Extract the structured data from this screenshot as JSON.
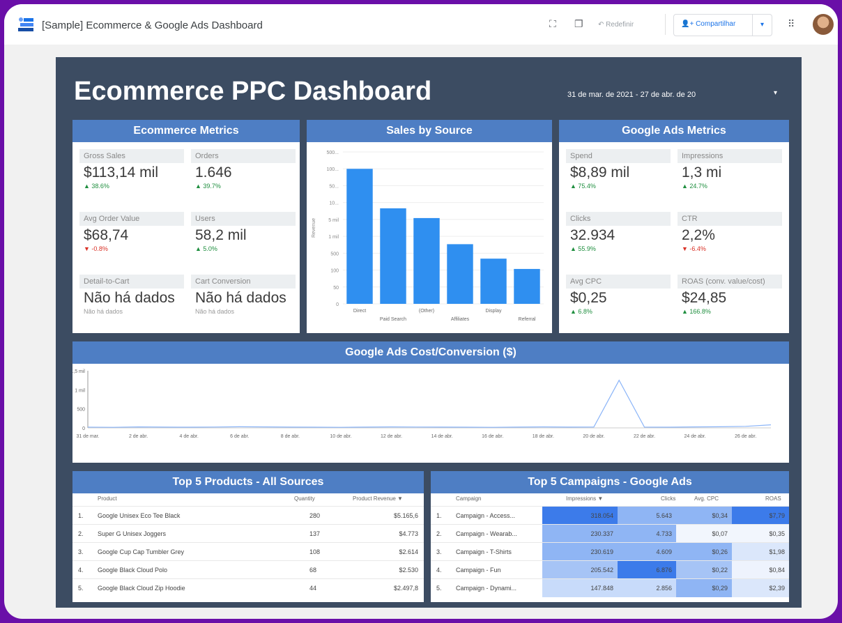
{
  "app": {
    "title": "[Sample] Ecommerce & Google Ads Dashboard",
    "reset_label": "Redefinir",
    "share_label": "Compartilhar"
  },
  "dashboard": {
    "title": "Ecommerce PPC Dashboard",
    "date_range": "31 de mar. de 2021 - 27 de abr. de 20"
  },
  "ecommerce_metrics": {
    "heading": "Ecommerce Metrics",
    "cards": [
      {
        "label": "Gross Sales",
        "value": "$113,14 mil",
        "delta": "▲ 38.6%",
        "trend": "up"
      },
      {
        "label": "Orders",
        "value": "1.646",
        "delta": "▲ 39.7%",
        "trend": "up"
      },
      {
        "label": "Avg Order Value",
        "value": "$68,74",
        "delta": "▼ -0.8%",
        "trend": "down"
      },
      {
        "label": "Users",
        "value": "58,2 mil",
        "delta": "▲ 5.0%",
        "trend": "up"
      },
      {
        "label": "Detail-to-Cart",
        "value": "Não há dados",
        "delta": "Não há dados",
        "trend": "none"
      },
      {
        "label": "Cart Conversion",
        "value": "Não há dados",
        "delta": "Não há dados",
        "trend": "none"
      }
    ]
  },
  "google_ads_metrics": {
    "heading": "Google Ads Metrics",
    "cards": [
      {
        "label": "Spend",
        "value": "$8,89 mil",
        "delta": "▲ 75.4%",
        "trend": "up"
      },
      {
        "label": "Impressions",
        "value": "1,3 mi",
        "delta": "▲ 24.7%",
        "trend": "up"
      },
      {
        "label": "Clicks",
        "value": "32.934",
        "delta": "▲ 55.9%",
        "trend": "up"
      },
      {
        "label": "CTR",
        "value": "2,2%",
        "delta": "▼ -6.4%",
        "trend": "down"
      },
      {
        "label": "Avg CPC",
        "value": "$0,25",
        "delta": "▲ 6.8%",
        "trend": "up"
      },
      {
        "label": "ROAS (conv. value/cost)",
        "value": "$24,85",
        "delta": "▲ 166.8%",
        "trend": "up"
      }
    ]
  },
  "chart_data": [
    {
      "type": "bar",
      "title": "Sales by Source",
      "ylabel": "Revenue",
      "scale": "log",
      "yticks": [
        "500...",
        "100...",
        "50...",
        "10...",
        "5 mil",
        "1 mil",
        "500",
        "100",
        "50",
        "0"
      ],
      "categories": [
        "Direct",
        "Paid Search",
        "(Other)",
        "Affiliates",
        "Display",
        "Referral"
      ],
      "values": [
        150000,
        9000,
        4500,
        700,
        250,
        120
      ],
      "color": "#2f8ff0"
    },
    {
      "type": "line",
      "title": "Google Ads  Cost/Conversion ($)",
      "yticks": [
        "1,5 mil",
        "1 mil",
        "500",
        "0"
      ],
      "ylim": [
        0,
        1500
      ],
      "x": [
        "31 de mar.",
        "1 de abr.",
        "2 de abr.",
        "3 de abr.",
        "4 de abr.",
        "5 de abr.",
        "6 de abr.",
        "7 de abr.",
        "8 de abr.",
        "9 de abr.",
        "10 de abr.",
        "11 de abr.",
        "12 de abr.",
        "13 de abr.",
        "14 de abr.",
        "15 de abr.",
        "16 de abr.",
        "17 de abr.",
        "18 de abr.",
        "19 de abr.",
        "20 de abr.",
        "21 de abr.",
        "22 de abr.",
        "23 de abr.",
        "24 de abr.",
        "25 de abr.",
        "26 de abr.",
        "27 de abr."
      ],
      "xtick_labels": [
        "31 de mar.",
        "2 de abr.",
        "4 de abr.",
        "6 de abr.",
        "8 de abr.",
        "10 de abr.",
        "12 de abr.",
        "14 de abr.",
        "16 de abr.",
        "18 de abr.",
        "20 de abr.",
        "22 de abr.",
        "24 de abr.",
        "26 de abr."
      ],
      "values": [
        20,
        15,
        25,
        20,
        18,
        22,
        30,
        25,
        20,
        18,
        15,
        20,
        25,
        22,
        20,
        18,
        15,
        20,
        25,
        20,
        22,
        1250,
        20,
        18,
        25,
        30,
        40,
        80
      ],
      "color": "#8ab4f8"
    }
  ],
  "top_products": {
    "heading": "Top 5 Products - All Sources",
    "columns": [
      "Product",
      "Quantity",
      "Product Revenue ▼"
    ],
    "rows": [
      {
        "n": "1.",
        "product": "Google Unisex Eco Tee Black",
        "qty": "280",
        "revenue": "$5.165,6"
      },
      {
        "n": "2.",
        "product": "Super G Unisex Joggers",
        "qty": "137",
        "revenue": "$4.773"
      },
      {
        "n": "3.",
        "product": "Google Cup Cap Tumbler Grey",
        "qty": "108",
        "revenue": "$2.614"
      },
      {
        "n": "4.",
        "product": "Google Black Cloud Polo",
        "qty": "68",
        "revenue": "$2.530"
      },
      {
        "n": "5.",
        "product": "Google Black Cloud Zip Hoodie",
        "qty": "44",
        "revenue": "$2.497,8"
      }
    ]
  },
  "top_campaigns": {
    "heading": "Top 5 Campaigns - Google Ads",
    "columns": [
      "Campaign",
      "Impressions ▼",
      "Clicks",
      "Avg. CPC",
      "ROAS"
    ],
    "rows": [
      {
        "n": "1.",
        "campaign": "Campaign - Access...",
        "impressions": "318.054",
        "clicks": "5.643",
        "cpc": "$0,34",
        "roas": "$7,79"
      },
      {
        "n": "2.",
        "campaign": "Campaign - Wearab...",
        "impressions": "230.337",
        "clicks": "4.733",
        "cpc": "$0,07",
        "roas": "$0,35"
      },
      {
        "n": "3.",
        "campaign": "Campaign - T-Shirts",
        "impressions": "230.619",
        "clicks": "4.609",
        "cpc": "$0,26",
        "roas": "$1,98"
      },
      {
        "n": "4.",
        "campaign": "Campaign - Fun",
        "impressions": "205.542",
        "clicks": "6.876",
        "cpc": "$0,22",
        "roas": "$0,84"
      },
      {
        "n": "5.",
        "campaign": "Campaign - Dynami...",
        "impressions": "147.848",
        "clicks": "2.856",
        "cpc": "$0,29",
        "roas": "$2,39"
      }
    ],
    "heat": {
      "impressions": [
        "#3c7bea",
        "#8fb5f4",
        "#8fb5f4",
        "#a6c4f6",
        "#c8dbfa"
      ],
      "clicks": [
        "#8fb5f4",
        "#8fb5f4",
        "#8fb5f4",
        "#3c7bea",
        "#c8dbfa"
      ],
      "cpc": [
        "#8fb5f4",
        "#f2f6fd",
        "#8fb5f4",
        "#a6c4f6",
        "#8fb5f4"
      ],
      "roas": [
        "#3c7bea",
        "#f2f6fd",
        "#dbe7fb",
        "#eef3fd",
        "#dbe7fb"
      ]
    }
  }
}
